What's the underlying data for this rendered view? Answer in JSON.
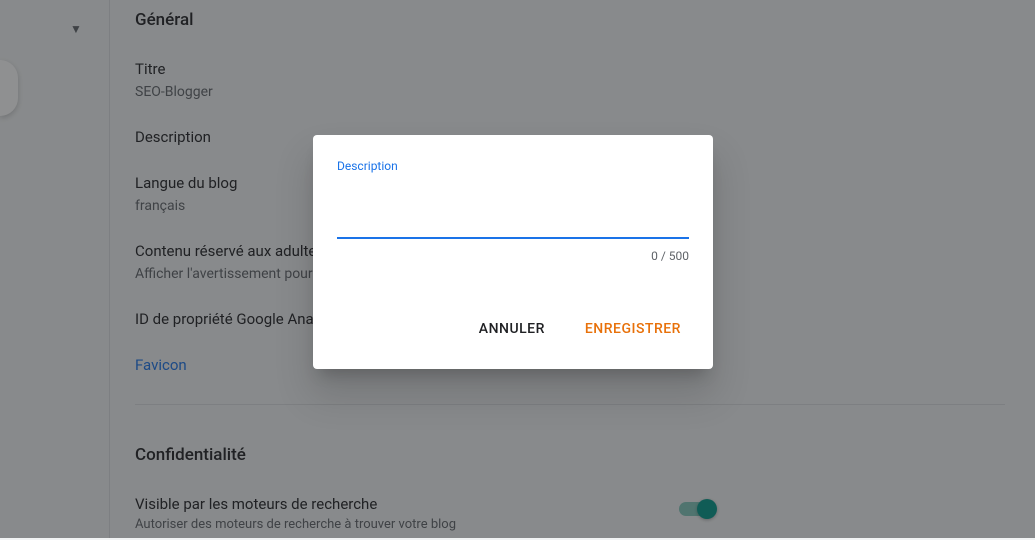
{
  "sections": {
    "general": {
      "title": "Général",
      "items": {
        "titre": {
          "label": "Titre",
          "value": "SEO-Blogger"
        },
        "description": {
          "label": "Description"
        },
        "langue": {
          "label": "Langue du blog",
          "value": "français"
        },
        "adult": {
          "label": "Contenu réservé aux adultes",
          "value": "Afficher l'avertissement pour"
        },
        "analytics": {
          "label": "ID de propriété Google Analytics"
        },
        "favicon": {
          "label": "Favicon"
        }
      }
    },
    "privacy": {
      "title": "Confidentialité",
      "visible": {
        "label": "Visible par les moteurs de recherche",
        "sublabel": "Autoriser des moteurs de recherche à trouver votre blog"
      }
    }
  },
  "dialog": {
    "field_label": "Description",
    "value": "",
    "counter": "0 / 500",
    "cancel": "ANNULER",
    "save": "ENREGISTRER"
  }
}
